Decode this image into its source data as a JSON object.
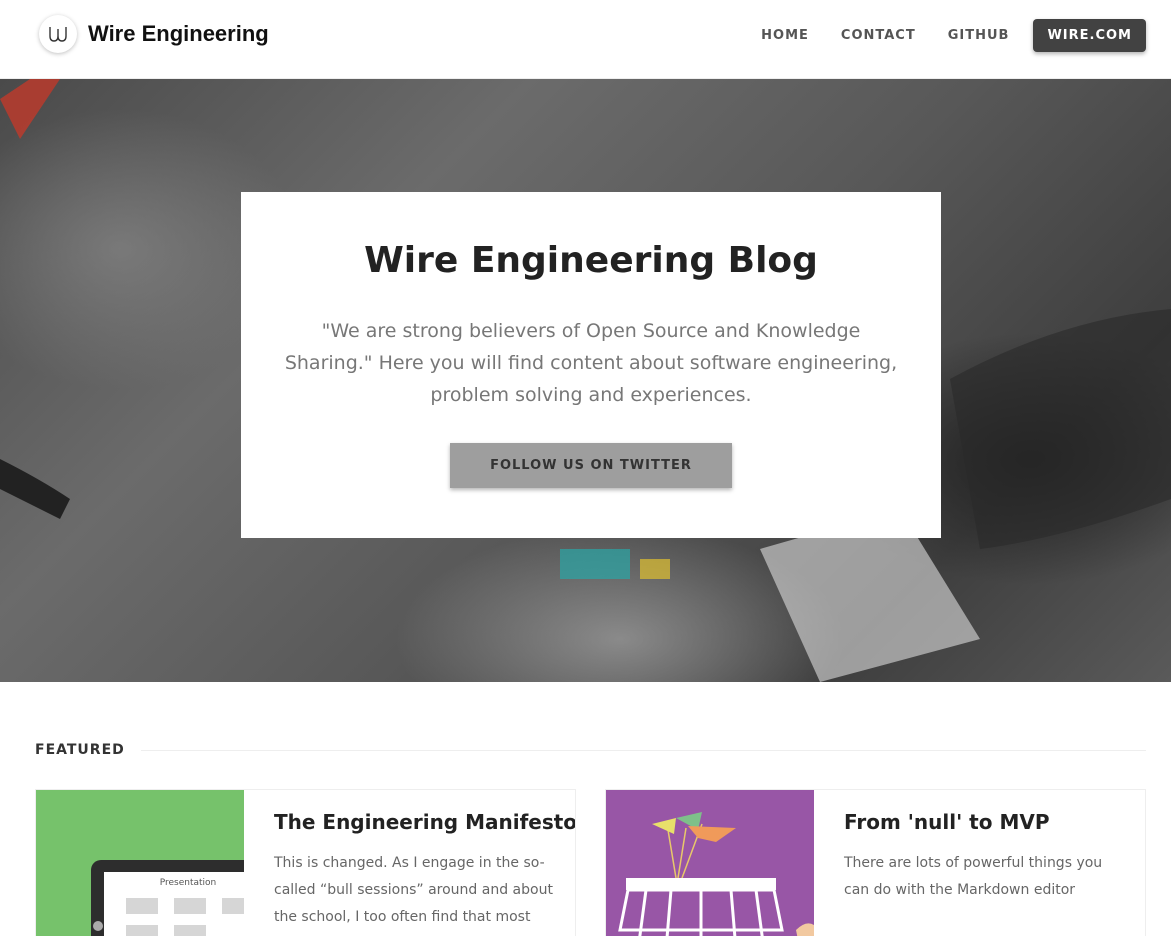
{
  "header": {
    "brand_name": "Wire Engineering",
    "nav": [
      {
        "label": "HOME"
      },
      {
        "label": "CONTACT"
      },
      {
        "label": "GITHUB"
      }
    ],
    "cta_label": "WIRE.COM"
  },
  "hero": {
    "title": "Wire Engineering Blog",
    "text": "\"We are strong believers of Open Source and Knowledge Sharing.\" Here you will find content about software engineering, problem solving and experiences.",
    "button_label": "FOLLOW US ON TWITTER"
  },
  "featured": {
    "label": "FEATURED",
    "posts": [
      {
        "title": "The Engineering Manifesto",
        "excerpt": "This is changed. As I engage in the so-called “bull sessions” around and about the school, I too often find that most",
        "image_caption": "Presentation",
        "image_color": "#76c26b",
        "image_icon": "presentation-illustration"
      },
      {
        "title": "From 'null' to MVP",
        "excerpt": "There are lots of powerful things you can do with the Markdown editor",
        "image_color": "#9856a6",
        "image_icon": "market-stall-illustration"
      }
    ]
  },
  "colors": {
    "nav_button": "#424242",
    "hero_button": "#9e9e9e",
    "accent_green": "#76c26b",
    "accent_purple": "#9856a6"
  }
}
